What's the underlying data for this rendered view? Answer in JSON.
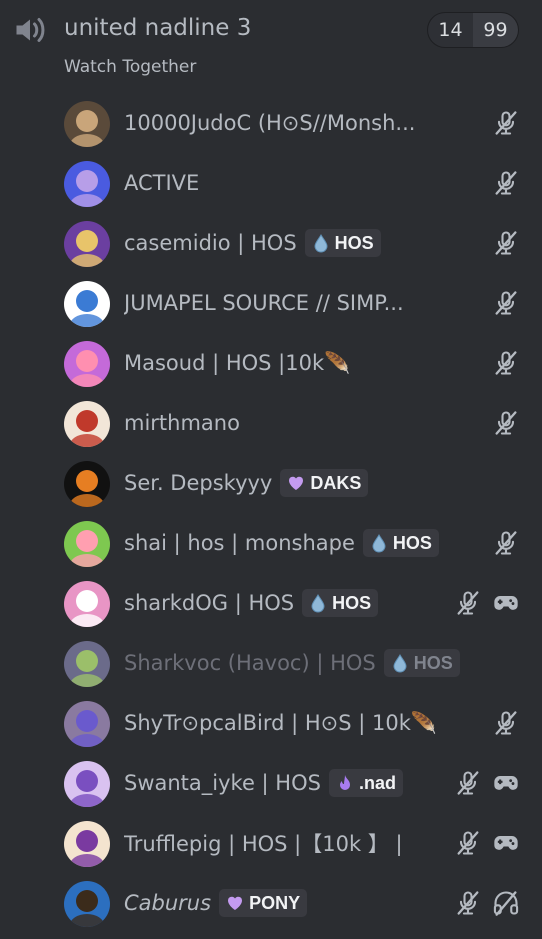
{
  "channel": {
    "name": "united nadline 3",
    "status": "Watch Together",
    "counter_left": "14",
    "counter_right": "99",
    "icon": "voice-speaker-icon"
  },
  "colors": {
    "background": "#2b2d31",
    "text": "#b5bac1",
    "tag_bg": "#393a40",
    "muted_icon": "#b5bac1"
  },
  "users": [
    {
      "name": "10000JudoC (H⊙S//Monsh...",
      "tag": "",
      "tag_icon": "",
      "status_icons": [
        "deafened-mic-icon"
      ]
    },
    {
      "name": "ACTIVE",
      "tag": "",
      "tag_icon": "",
      "status_icons": [
        "deafened-mic-icon"
      ]
    },
    {
      "name": "casemidio | HOS",
      "tag": "HOS",
      "tag_icon": "drop-icon",
      "status_icons": [
        "deafened-mic-icon"
      ]
    },
    {
      "name": "JUMAPEL SOURCE // SIMP...",
      "tag": "",
      "tag_icon": "",
      "status_icons": [
        "deafened-mic-icon"
      ]
    },
    {
      "name": "Masoud | HOS |10k🪶",
      "tag": "",
      "tag_icon": "",
      "status_icons": [
        "deafened-mic-icon"
      ]
    },
    {
      "name": "mirthmano",
      "tag": "",
      "tag_icon": "",
      "status_icons": [
        "deafened-mic-icon"
      ]
    },
    {
      "name": "Ser. Depskyyy",
      "tag": "DAKS",
      "tag_icon": "heart-icon",
      "status_icons": []
    },
    {
      "name": "shai | hos | monshape",
      "tag": "HOS",
      "tag_icon": "drop-icon",
      "status_icons": [
        "deafened-mic-icon"
      ]
    },
    {
      "name": "sharkdOG | HOS",
      "tag": "HOS",
      "tag_icon": "drop-icon",
      "status_icons": [
        "muted-mic-icon",
        "gamepad-icon"
      ]
    },
    {
      "name": "Sharkvoc (Havoc) | HOS",
      "tag": "HOS",
      "tag_icon": "drop-icon",
      "status_icons": [],
      "dim": true
    },
    {
      "name": "ShyTr⊙pcalBird | H⊙S | 10k🪶",
      "tag": "",
      "tag_icon": "",
      "status_icons": [
        "deafened-mic-icon"
      ]
    },
    {
      "name": "Swanta_iyke | HOS",
      "tag": ".nad",
      "tag_icon": "flame-icon",
      "status_icons": [
        "muted-mic-icon",
        "gamepad-icon"
      ]
    },
    {
      "name": "Trufflepig | HOS |【10k 】 |",
      "tag": "",
      "tag_icon": "",
      "status_icons": [
        "muted-mic-icon",
        "gamepad-icon"
      ]
    },
    {
      "name": "Caburus",
      "tag": "PONY",
      "tag_icon": "heart-icon",
      "status_icons": [
        "muted-mic-icon",
        "deafened-headphones-icon"
      ],
      "italic": true
    }
  ]
}
